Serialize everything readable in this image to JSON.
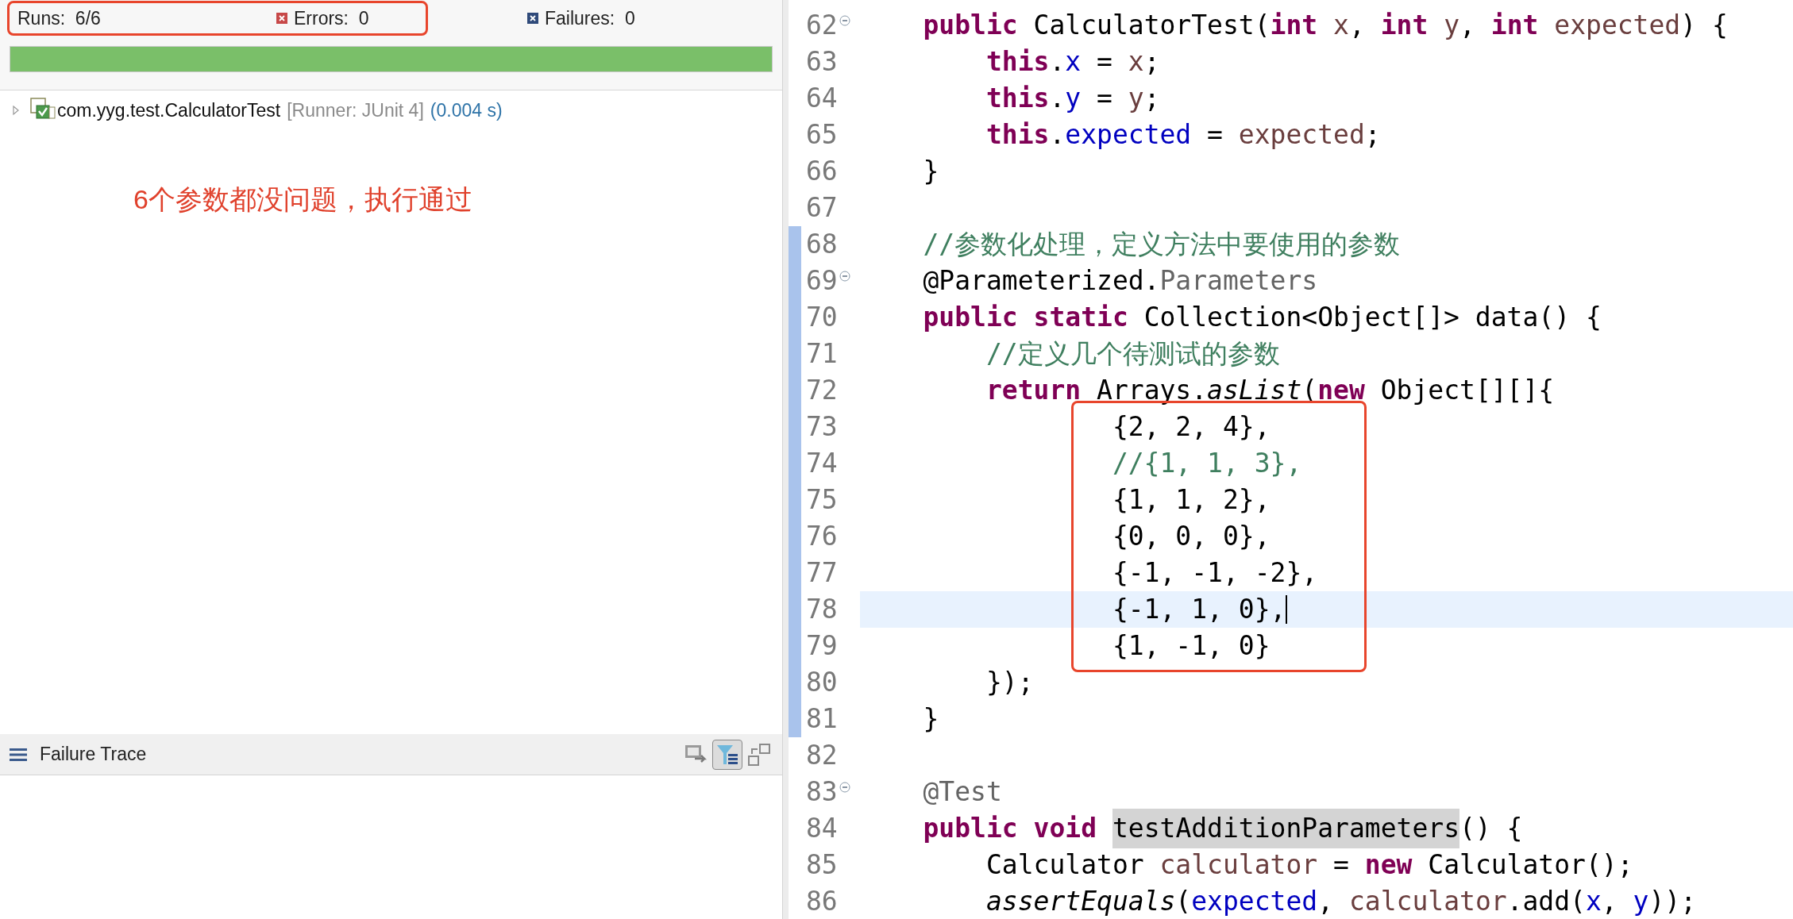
{
  "junit": {
    "runs_label": "Runs:",
    "runs": "6/6",
    "errors_label": "Errors:",
    "errors": "0",
    "failures_label": "Failures:",
    "failures": "0",
    "progress": {
      "level": 1,
      "passed": true
    },
    "tree": [
      {
        "name": "com.yyg.test.CalculatorTest",
        "runner": "[Runner: JUnit 4]",
        "time": "(0.004 s)",
        "expanded": false
      }
    ],
    "note": "6个参数都没问题，执行通过",
    "failure_trace": {
      "title": "Failure Trace",
      "toolbar": [
        {
          "kind": "compare",
          "on": false
        },
        {
          "kind": "filter",
          "on": true
        },
        {
          "kind": "layout",
          "on": false
        }
      ]
    }
  },
  "editor": {
    "lines": [
      {
        "no": "62",
        "fold": true,
        "changed": false,
        "current": false,
        "tokens": [
          {
            "t": "    public",
            "kind": "kw"
          },
          {
            "t": " CalculatorTest("
          },
          {
            "t": "int",
            "kind": "kw"
          },
          {
            "t": " x",
            "kind": "local"
          },
          {
            "t": ", "
          },
          {
            "t": "int",
            "kind": "kw"
          },
          {
            "t": " y",
            "kind": "local"
          },
          {
            "t": ", "
          },
          {
            "t": "int",
            "kind": "kw"
          },
          {
            "t": " expected",
            "kind": "local"
          },
          {
            "t": ") {"
          }
        ]
      },
      {
        "no": "63",
        "fold": false,
        "changed": false,
        "current": false,
        "tokens": [
          {
            "t": "        this",
            "kind": "kw"
          },
          {
            "t": "."
          },
          {
            "t": "x",
            "kind": "field"
          },
          {
            "t": " = "
          },
          {
            "t": "x",
            "kind": "local"
          },
          {
            "t": ";"
          }
        ]
      },
      {
        "no": "64",
        "fold": false,
        "changed": false,
        "current": false,
        "tokens": [
          {
            "t": "        this",
            "kind": "kw"
          },
          {
            "t": "."
          },
          {
            "t": "y",
            "kind": "field"
          },
          {
            "t": " = "
          },
          {
            "t": "y",
            "kind": "local"
          },
          {
            "t": ";"
          }
        ]
      },
      {
        "no": "65",
        "fold": false,
        "changed": false,
        "current": false,
        "tokens": [
          {
            "t": "        this",
            "kind": "kw"
          },
          {
            "t": "."
          },
          {
            "t": "expected",
            "kind": "field"
          },
          {
            "t": " = "
          },
          {
            "t": "expected",
            "kind": "local"
          },
          {
            "t": ";"
          }
        ]
      },
      {
        "no": "66",
        "fold": false,
        "changed": false,
        "current": false,
        "tokens": [
          {
            "t": "    }"
          }
        ]
      },
      {
        "no": "67",
        "fold": false,
        "changed": false
      },
      {
        "no": "68",
        "fold": false,
        "changed": true,
        "current": false,
        "tokens": [
          {
            "t": "    //参数化处理，定义方法中要使用的参数",
            "kind": "comment"
          }
        ]
      },
      {
        "no": "69",
        "fold": true,
        "changed": true,
        "current": false,
        "tokens": [
          {
            "t": "    @Parameterized."
          },
          {
            "t": "Parameters",
            "kind": "annot"
          }
        ]
      },
      {
        "no": "70",
        "fold": false,
        "changed": true,
        "current": false,
        "tokens": [
          {
            "t": "    public",
            "kind": "kw"
          },
          {
            "t": " static",
            "kind": "kw"
          },
          {
            "t": " Collection<Object[]> data() {"
          }
        ]
      },
      {
        "no": "71",
        "fold": false,
        "changed": true,
        "current": false,
        "tokens": [
          {
            "t": "        //定义几个待测试的参数",
            "kind": "comment"
          }
        ]
      },
      {
        "no": "72",
        "fold": false,
        "changed": true,
        "current": false,
        "tokens": [
          {
            "t": "        return",
            "kind": "kw"
          },
          {
            "t": " Arrays."
          },
          {
            "t": "asList",
            "kind": "italic"
          },
          {
            "t": "("
          },
          {
            "t": "new",
            "kind": "kw"
          },
          {
            "t": " Object[][]{"
          }
        ]
      },
      {
        "no": "73",
        "fold": false,
        "changed": true,
        "current": false,
        "tokens": [
          {
            "t": "                {2, 2, 4},"
          }
        ]
      },
      {
        "no": "74",
        "fold": false,
        "changed": true,
        "current": false,
        "tokens": [
          {
            "t": "                //{1, 1, 3},",
            "kind": "comment"
          }
        ]
      },
      {
        "no": "75",
        "fold": false,
        "changed": true,
        "current": false,
        "tokens": [
          {
            "t": "                {1, 1, 2},"
          }
        ]
      },
      {
        "no": "76",
        "fold": false,
        "changed": true,
        "current": false,
        "tokens": [
          {
            "t": "                {0, 0, 0},"
          }
        ]
      },
      {
        "no": "77",
        "fold": false,
        "changed": true,
        "current": false,
        "tokens": [
          {
            "t": "                {-1, -1, -2},"
          }
        ]
      },
      {
        "no": "78",
        "fold": false,
        "changed": true,
        "current": true,
        "tokens": [
          {
            "t": "                {-1, 1, 0},"
          }
        ]
      },
      {
        "no": "79",
        "fold": false,
        "changed": true,
        "current": false,
        "tokens": [
          {
            "t": "                {1, -1, 0}"
          }
        ]
      },
      {
        "no": "80",
        "fold": false,
        "changed": true,
        "current": false,
        "tokens": [
          {
            "t": "        });"
          }
        ]
      },
      {
        "no": "81",
        "fold": false,
        "changed": true,
        "current": false,
        "tokens": [
          {
            "t": "    }"
          }
        ]
      },
      {
        "no": "82",
        "fold": false,
        "changed": false
      },
      {
        "no": "83",
        "fold": true,
        "changed": false,
        "current": false,
        "tokens": [
          {
            "t": "    @Test",
            "kind": "annot"
          }
        ]
      },
      {
        "no": "84",
        "fold": false,
        "changed": false,
        "current": false,
        "tokens": [
          {
            "t": "    public",
            "kind": "kw"
          },
          {
            "t": " void ",
            "kind": "kw"
          },
          {
            "t": "testAdditionParameters",
            "kind": "hl"
          },
          {
            "t": "() {"
          }
        ]
      },
      {
        "no": "85",
        "fold": false,
        "changed": false,
        "current": false,
        "tokens": [
          {
            "t": "        Calculator "
          },
          {
            "t": "calculator",
            "kind": "local"
          },
          {
            "t": " = "
          },
          {
            "t": "new",
            "kind": "kw"
          },
          {
            "t": " Calculator();"
          }
        ]
      },
      {
        "no": "86",
        "fold": false,
        "changed": false,
        "current": false,
        "tokens": [
          {
            "t": "        assertEquals",
            "kind": "italic"
          },
          {
            "t": "("
          },
          {
            "t": "expected",
            "kind": "field"
          },
          {
            "t": ", "
          },
          {
            "t": "calculator",
            "kind": "local"
          },
          {
            "t": ".add("
          },
          {
            "t": "x",
            "kind": "field"
          },
          {
            "t": ", "
          },
          {
            "t": "y",
            "kind": "field"
          },
          {
            "t": "));"
          }
        ]
      }
    ]
  }
}
